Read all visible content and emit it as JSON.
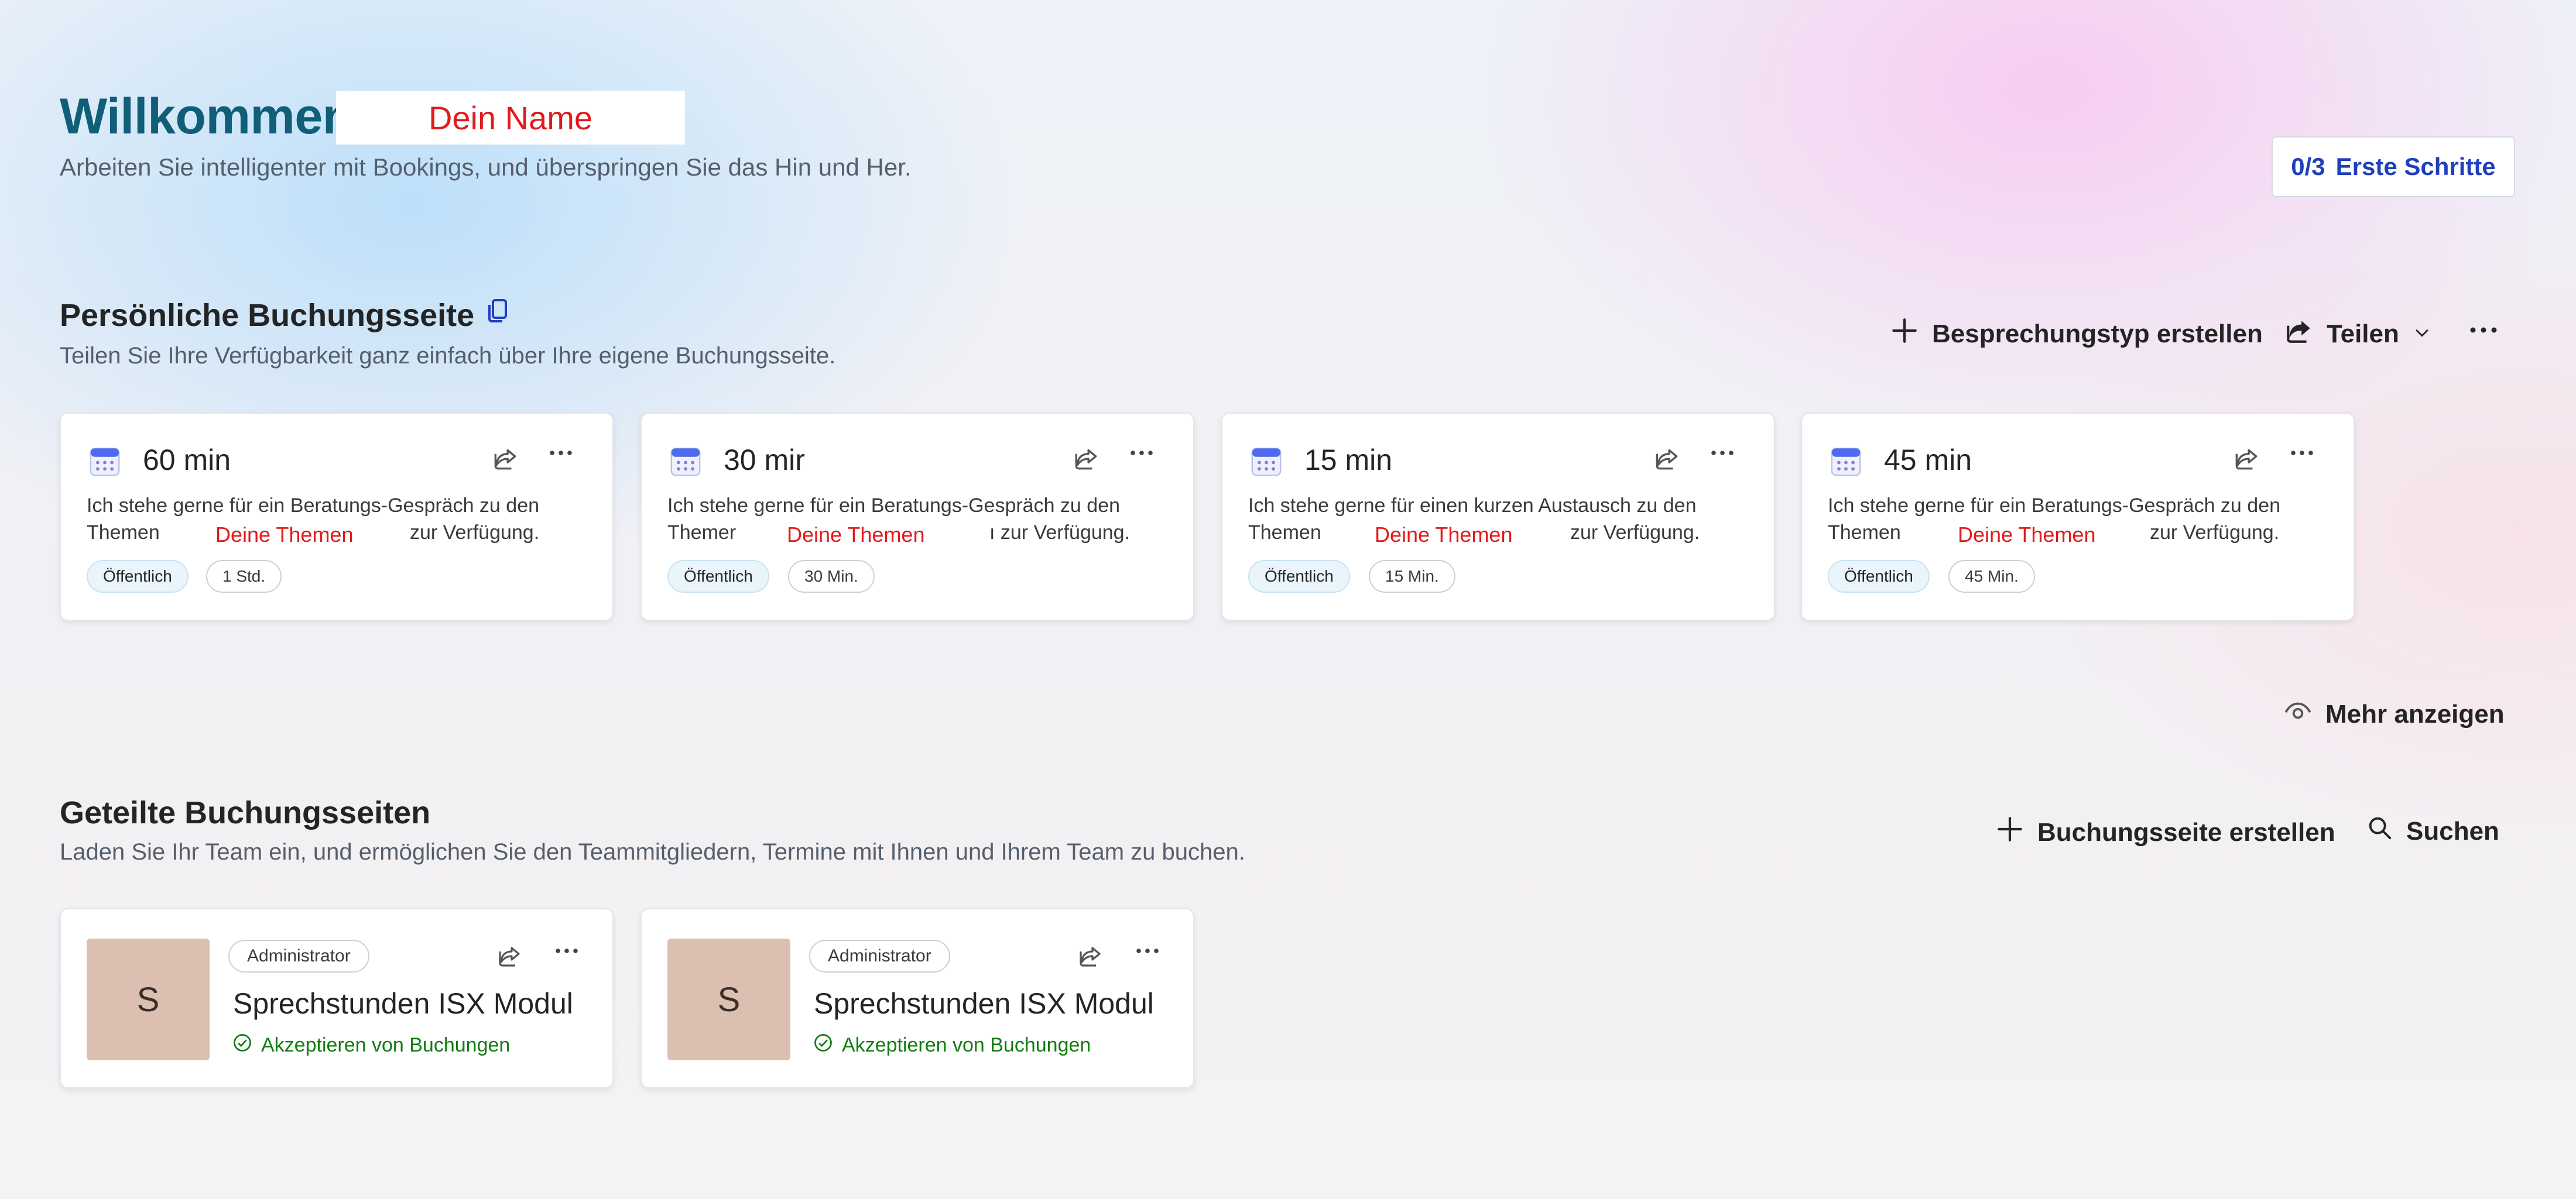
{
  "header": {
    "welcome": "Willkommen",
    "name_placeholder": "Dein Name",
    "subtitle": "Arbeiten Sie intelligenter mit Bookings, und überspringen Sie das Hin und Her.",
    "steps_count": "0/3",
    "steps_label": "Erste Schritte"
  },
  "personal": {
    "title": "Persönliche Buchungsseite",
    "subtitle": "Teilen Sie Ihre Verfügbarkeit ganz einfach über Ihre eigene Buchungsseite.",
    "create_label": "Besprechungstyp erstellen",
    "share_label": "Teilen",
    "show_more_label": "Mehr anzeigen"
  },
  "meetings": [
    {
      "title": "60 min",
      "desc_line1": "Ich stehe gerne für ein Beratungs-Gespräch zu den",
      "desc_prefix": "Themen",
      "topic": "Deine Themen",
      "desc_suffix": "zur Verfügung.",
      "visibility": "Öffentlich",
      "duration": "1 Std."
    },
    {
      "title": "30 mir",
      "desc_line1": "Ich stehe gerne für ein Beratungs-Gespräch zu den",
      "desc_prefix": "Themer",
      "topic": "Deine Themen",
      "desc_suffix": "ı zur Verfügung.",
      "visibility": "Öffentlich",
      "duration": "30 Min."
    },
    {
      "title": "15 min",
      "desc_line1": "Ich stehe gerne für einen kurzen Austausch zu den",
      "desc_prefix": "Themen",
      "topic": "Deine Themen",
      "desc_suffix": "zur Verfügung.",
      "visibility": "Öffentlich",
      "duration": "15 Min."
    },
    {
      "title": "45 min",
      "desc_line1": "Ich stehe gerne für ein Beratungs-Gespräch zu den",
      "desc_prefix": "Themen",
      "topic": "Deine Themen",
      "desc_suffix": "zur Verfügung.",
      "visibility": "Öffentlich",
      "duration": "45 Min."
    }
  ],
  "shared": {
    "title": "Geteilte Buchungsseiten",
    "subtitle": "Laden Sie Ihr Team ein, und ermöglichen Sie den Teammitgliedern, Termine mit Ihnen und Ihrem Team zu buchen.",
    "create_label": "Buchungsseite erstellen",
    "search_label": "Suchen"
  },
  "booking_pages": [
    {
      "initial": "S",
      "role": "Administrator",
      "title": "Sprechstunden ISX Modul",
      "status": "Akzeptieren von Buchungen"
    },
    {
      "initial": "S",
      "role": "Administrator",
      "title": "Sprechstunden ISX Modul",
      "status": "Akzeptieren von Buchungen"
    }
  ],
  "colors": {
    "accent_teal": "#115e78",
    "link_blue": "#1f3fbf",
    "placeholder_red": "#e3191c",
    "status_green": "#107c10"
  },
  "icons": {
    "copy": "copy-icon",
    "add": "add-icon",
    "share": "share-icon",
    "chevron": "chevron-down-icon",
    "more": "more-icon",
    "calendar": "calendar-icon",
    "eye": "eye-icon",
    "search": "search-icon",
    "check": "check-circle-icon"
  }
}
